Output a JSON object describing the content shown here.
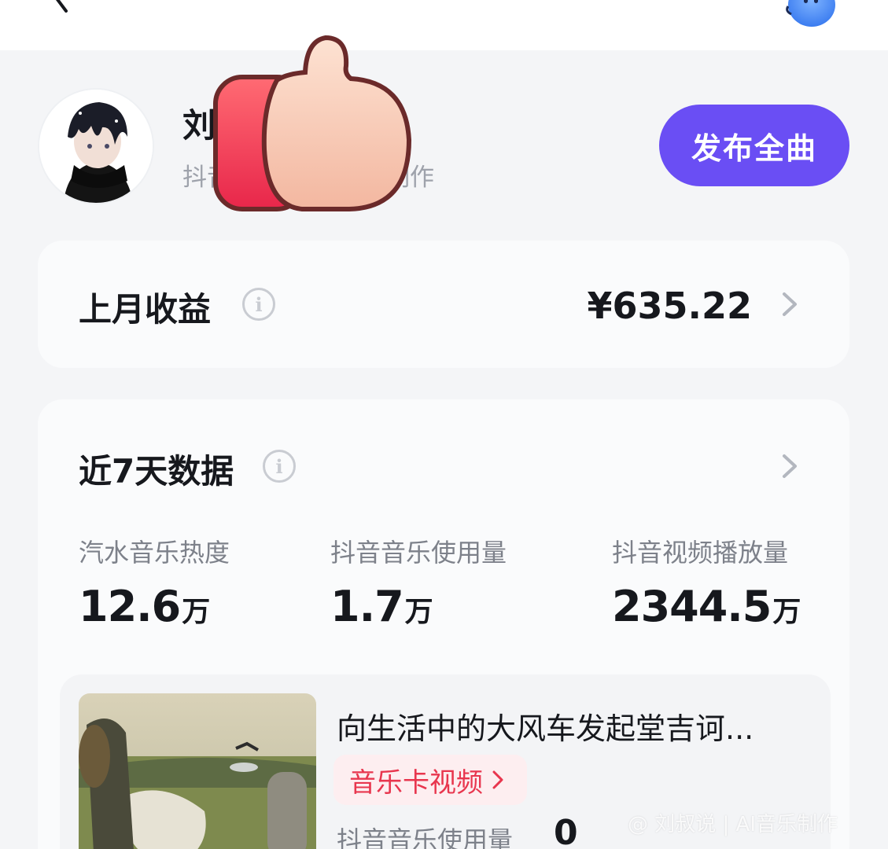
{
  "header": {
    "back_icon": "back-arrow-icon",
    "assistant_icon": "bot-face-icon"
  },
  "profile": {
    "name_visible": "刘",
    "subtitle_start": "抖音",
    "subtitle_end": "制作",
    "publish_label": "发布全曲"
  },
  "overlay": {
    "icon": "thumbs-up-icon"
  },
  "earnings": {
    "title": "上月收益",
    "value": "¥635.22"
  },
  "stats": {
    "title": "近7天数据",
    "metrics": [
      {
        "label": "汽水音乐热度",
        "value": "12.6",
        "unit": "万"
      },
      {
        "label": "抖音音乐使用量",
        "value": "1.7",
        "unit": "万"
      },
      {
        "label": "抖音视频播放量",
        "value": "2344.5",
        "unit": "万"
      }
    ]
  },
  "song": {
    "title": "向生活中的大风车发起堂吉诃...",
    "tag": "音乐卡视频",
    "usage_label": "抖音音乐使用量",
    "usage_value": "0"
  },
  "watermark": "@ 刘叔说 | AI音乐制作",
  "colors": {
    "accent": "#6a4ef4",
    "tag_red": "#e8364e",
    "background": "#f4f5f7"
  }
}
